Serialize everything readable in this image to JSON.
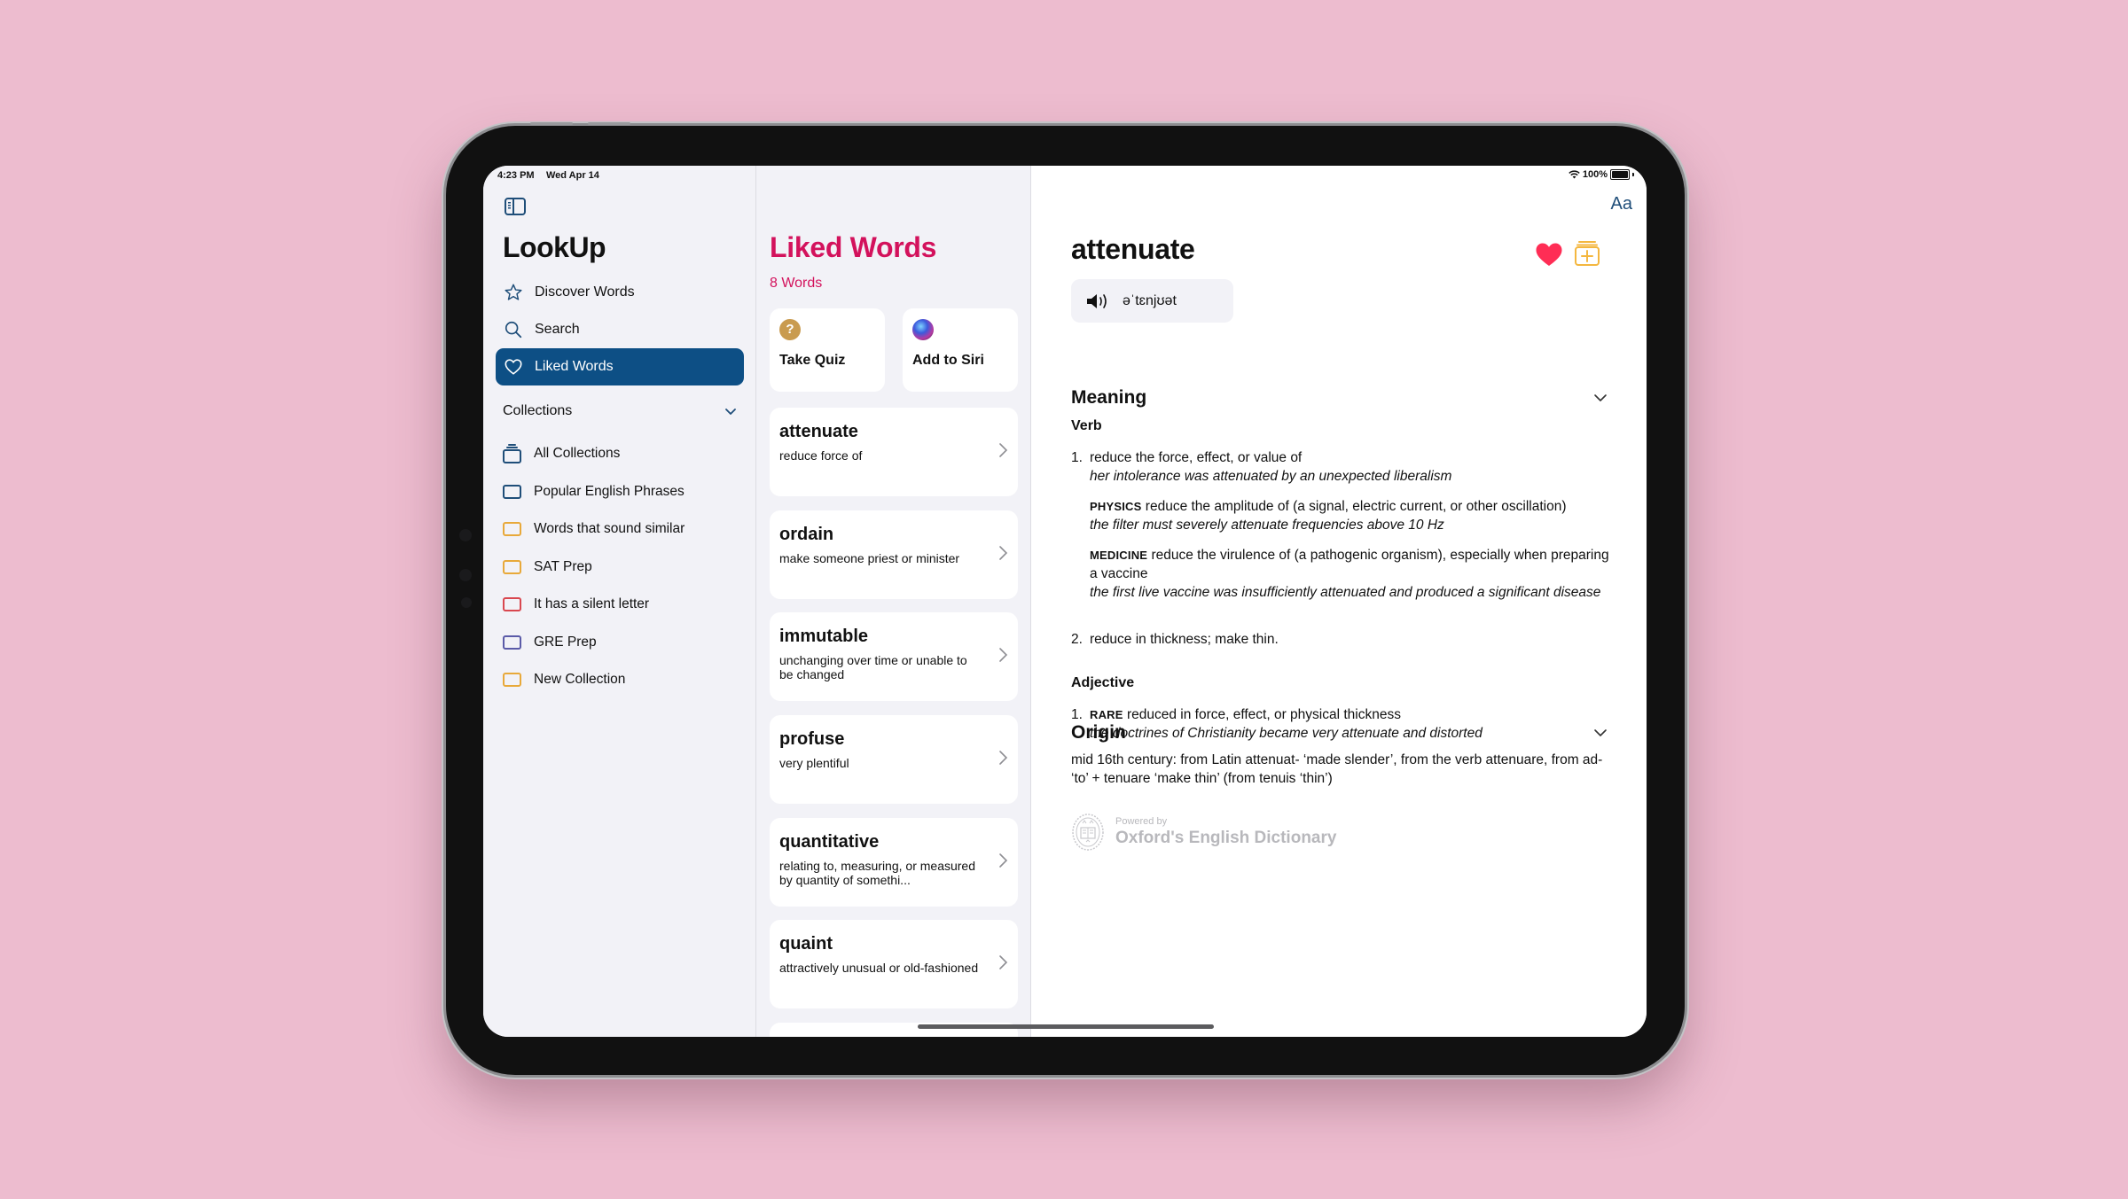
{
  "status_bar": {
    "time": "4:23 PM",
    "date": "Wed Apr 14",
    "battery": "100%"
  },
  "sidebar": {
    "app_title": "LookUp",
    "nav": [
      {
        "label": "Discover Words",
        "icon": "star-icon"
      },
      {
        "label": "Search",
        "icon": "search-icon"
      },
      {
        "label": "Liked Words",
        "icon": "heart-icon",
        "active": true
      }
    ],
    "collections_label": "Collections",
    "collections": [
      {
        "label": "All Collections",
        "color": "#1f4e79"
      },
      {
        "label": "Popular English Phrases",
        "color": "#1f4e79"
      },
      {
        "label": "Words that sound similar",
        "color": "#E8A93A"
      },
      {
        "label": "SAT Prep",
        "color": "#E8A93A"
      },
      {
        "label": "It has a silent letter",
        "color": "#D9474F"
      },
      {
        "label": "GRE Prep",
        "color": "#5B5BA8"
      },
      {
        "label": "New Collection",
        "color": "#E8A93A"
      }
    ]
  },
  "list": {
    "title": "Liked Words",
    "count": "8 Words",
    "accent": "#D3125C",
    "actions": [
      {
        "label": "Take Quiz",
        "icon": "quiz-icon",
        "glyph": "?"
      },
      {
        "label": "Add to Siri",
        "icon": "siri-icon"
      }
    ],
    "words": [
      {
        "word": "attenuate",
        "definition": "reduce force of"
      },
      {
        "word": "ordain",
        "definition": "make someone priest or minister"
      },
      {
        "word": "immutable",
        "definition": "unchanging over time or unable to be changed"
      },
      {
        "word": "profuse",
        "definition": "very plentiful"
      },
      {
        "word": "quantitative",
        "definition": "relating to, measuring, or measured by quantity of somethi..."
      },
      {
        "word": "quaint",
        "definition": "attractively unusual or old-fashioned"
      }
    ]
  },
  "detail": {
    "font_button": "Aa",
    "word": "attenuate",
    "pronunciation": "əˈtɛnjʊət",
    "like_color": "#FF2D55",
    "collection_color": "#F4B73F",
    "meaning_title": "Meaning",
    "verb_label": "Verb",
    "verb_defs": {
      "d1_num": "1.",
      "d1_text": "reduce the force, effect, or value of",
      "d1_example": "her intolerance was attenuated by an unexpected liberalism",
      "d1a_tag": "PHYSICS",
      "d1a_text": "reduce the amplitude of (a signal, electric current, or other oscillation)",
      "d1a_example": "the filter must severely attenuate frequencies above 10 Hz",
      "d1b_tag": "MEDICINE",
      "d1b_text": "reduce the virulence of (a pathogenic organism), especially when preparing a vaccine",
      "d1b_example": "the first live vaccine was insufficiently attenuated and produced a significant disease",
      "d2_num": "2.",
      "d2_text": "reduce in thickness; make thin."
    },
    "adjective_label": "Adjective",
    "adj_defs": {
      "d1_num": "1.",
      "d1_tag": "RARE",
      "d1_text": "reduced in force, effect, or physical thickness",
      "d1_example": "the doctrines of Christianity became very attenuate and distorted"
    },
    "origin_title": "Origin",
    "origin_text": "mid 16th century: from Latin attenuat- ‘made slender’, from the verb attenuare, from ad- ‘to’ + tenuare ‘make thin’ (from tenuis ‘thin’)",
    "powered_by": "Powered by",
    "source": "Oxford's English Dictionary"
  }
}
